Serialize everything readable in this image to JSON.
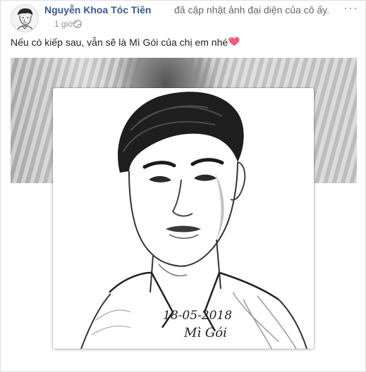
{
  "post": {
    "author": "Nguyễn Khoa Tóc Tiên",
    "action": "đã cập nhật ảnh đại diện của cô ấy.",
    "time": "1 giờ",
    "separator": "·",
    "caption": "Nếu có kiếp sau, vẫn sẽ là Mì Gói của chị em nhé",
    "more_label": "···",
    "icons": {
      "privacy": "globe-icon",
      "emoji": "heart-icon",
      "menu": "more-options-icon"
    }
  },
  "profile_picture": {
    "signature_date": "18-05-2018",
    "signature_text": "Mì Gói"
  },
  "colors": {
    "link": "#385898",
    "secondary_text": "#90949c",
    "heart": "#f05a7e"
  }
}
